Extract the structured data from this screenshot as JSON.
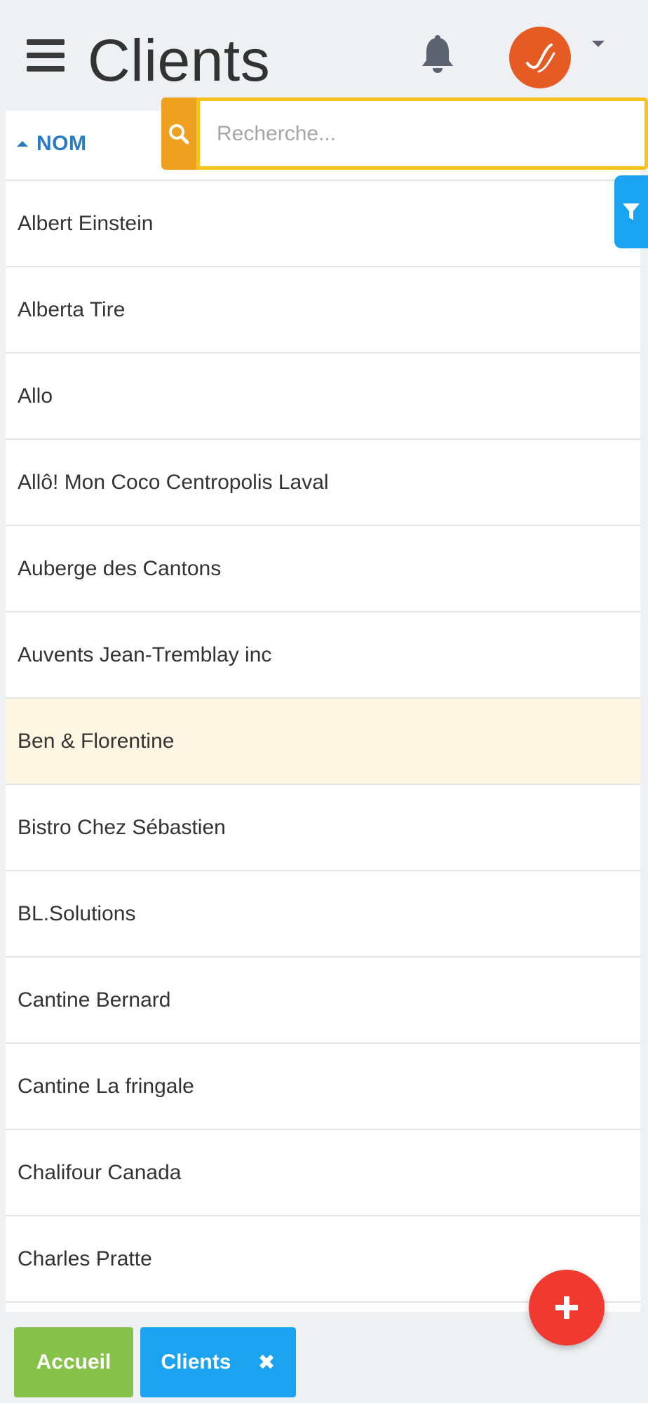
{
  "header": {
    "title": "Clients"
  },
  "sort": {
    "label": "NOM"
  },
  "search": {
    "placeholder": "Recherche..."
  },
  "clients": [
    "Albert Einstein",
    "Alberta Tire",
    "Allo",
    "Allô! Mon Coco Centropolis Laval",
    "Auberge des Cantons",
    "Auvents Jean-Tremblay inc",
    "Ben & Florentine",
    "Bistro Chez Sébastien",
    "BL.Solutions",
    "Cantine Bernard",
    "Cantine La fringale",
    "Chalifour Canada",
    "Charles Pratte"
  ],
  "bottom": {
    "home_label": "Accueil",
    "clients_label": "Clients",
    "close_glyph": "✖"
  },
  "icons": {
    "menu": "hamburger-icon",
    "bell": "bell-icon",
    "search": "search-icon",
    "filter": "filter-icon",
    "add": "plus-icon"
  },
  "colors": {
    "accent_blue": "#2a7bc6",
    "search_orange": "#f0a020",
    "search_border": "#f8c21c",
    "filter_blue": "#1aa3f0",
    "fab_red": "#f03a2f",
    "home_green": "#86c14a",
    "avatar_orange": "#e65a24",
    "highlight_row": "#fcf6e2"
  }
}
